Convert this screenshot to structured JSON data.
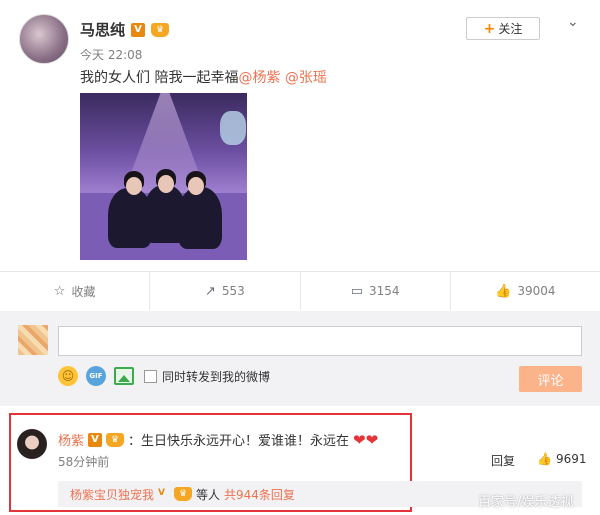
{
  "post": {
    "author": "马思纯",
    "timestamp": "今天 22:08",
    "text_prefix": "我的女人们 陪我一起幸福",
    "mention_1": "@杨紫",
    "mention_2": "@张瑶",
    "follow_label": "关注"
  },
  "actions": {
    "favorite": "收藏",
    "repost": "553",
    "comment": "3154",
    "like": "39004"
  },
  "composer": {
    "input_value": "",
    "repost_label": "同时转发到我的微博",
    "submit_label": "评论"
  },
  "comment": {
    "author": "杨紫",
    "text": "：生日快乐永远开心！爱谁谁！永远在",
    "time": "58分钟前",
    "reply_label": "回复",
    "likes": "9691",
    "sub_reply": {
      "author": "杨紫宝贝独宠我",
      "middle": "等人",
      "count": "共944条回复"
    }
  },
  "watermark": "百家号/娱乐透视",
  "colors": {
    "accent": "#eb7350",
    "highlight_border": "#e5333a",
    "verified": "#e8880e",
    "follow_plus": "#ff8200"
  }
}
